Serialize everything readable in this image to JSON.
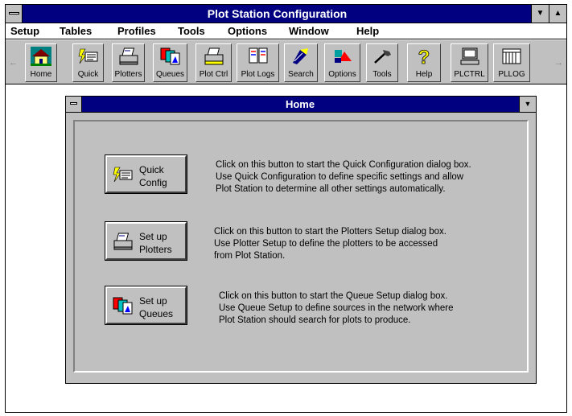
{
  "window": {
    "title": "Plot Station Configuration",
    "minimize_glyph": "▼",
    "maximize_glyph": "▲"
  },
  "menu": [
    "Setup",
    "Tables",
    "Profiles",
    "Tools",
    "Options",
    "Window",
    "Help"
  ],
  "toolbar": {
    "left_arrow": "←",
    "right_arrow": "→",
    "buttons": [
      {
        "label": "Home",
        "icon": "house-icon"
      },
      {
        "label": "Quick",
        "icon": "quick-config-icon"
      },
      {
        "label": "Plotters",
        "icon": "plotter-icon"
      },
      {
        "label": "Queues",
        "icon": "queues-icon"
      },
      {
        "label": "Plot Ctrl",
        "icon": "plot-ctrl-icon"
      },
      {
        "label": "Plot Logs",
        "icon": "plot-logs-icon"
      },
      {
        "label": "Search",
        "icon": "search-icon"
      },
      {
        "label": "Options",
        "icon": "options-icon"
      },
      {
        "label": "Tools",
        "icon": "tools-icon"
      },
      {
        "label": "Help",
        "icon": "help-icon"
      },
      {
        "label": "PLCTRL",
        "icon": "computer-icon"
      },
      {
        "label": "PLLOG",
        "icon": "log-icon"
      }
    ]
  },
  "home": {
    "title": "Home",
    "dropdown_glyph": "▼",
    "actions": [
      {
        "label_line1": "Quick",
        "label_line2": "Config",
        "icon": "quick-config-icon",
        "desc": [
          "Click on this button to start the Quick Configuration dialog box.",
          "Use Quick Configuration to define specific settings and allow",
          "Plot Station to determine all other settings automatically."
        ]
      },
      {
        "label_line1": "Set up",
        "label_line2": "Plotters",
        "icon": "plotter-icon",
        "desc": [
          "Click on this button to start the Plotters Setup dialog box.",
          "Use Plotter Setup to define the plotters to be accessed",
          "from Plot Station."
        ]
      },
      {
        "label_line1": "Set up",
        "label_line2": "Queues",
        "icon": "queues-icon",
        "desc": [
          "Click on this button to start the Queue Setup dialog box.",
          "Use Queue Setup to define sources in the network where",
          "Plot Station should search for plots to produce."
        ]
      }
    ]
  }
}
